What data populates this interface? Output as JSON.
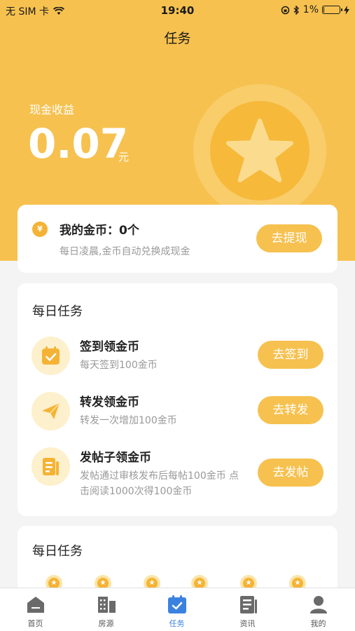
{
  "status_bar": {
    "carrier": "无 SIM 卡",
    "time": "19:40",
    "battery_percent_text": "1%",
    "battery_level": 0.01
  },
  "header": {
    "title": "任务"
  },
  "earnings": {
    "label": "现金收益",
    "value": "0.07",
    "unit": "元"
  },
  "my_coins": {
    "title": "我的金币：0个",
    "subtitle": "每日凌晨,金币自动兑换成现金",
    "button": "去提现"
  },
  "daily_tasks": {
    "title": "每日任务",
    "tasks": [
      {
        "title": "签到领金币",
        "subtitle": "每天签到100金币",
        "button": "去签到",
        "icon": "calendar-check-icon"
      },
      {
        "title": "转发领金币",
        "subtitle": "转发一次增加100金币",
        "button": "去转发",
        "icon": "paper-plane-icon"
      },
      {
        "title": "发帖子领金币",
        "subtitle": "发帖通过审核发布后每帖100金币 点击阅读1000次得100金币",
        "button": "去发帖",
        "icon": "document-icon"
      }
    ]
  },
  "daily_tasks_2": {
    "title": "每日任务"
  },
  "tabs": [
    {
      "label": "首页",
      "icon": "home-icon",
      "active": false
    },
    {
      "label": "房源",
      "icon": "buildings-icon",
      "active": false
    },
    {
      "label": "任务",
      "icon": "calendar-task-icon",
      "active": true
    },
    {
      "label": "资讯",
      "icon": "news-icon",
      "active": false
    },
    {
      "label": "我的",
      "icon": "user-icon",
      "active": false
    }
  ],
  "colors": {
    "accent": "#f6c14f",
    "coin": "#f5b335",
    "tab_active": "#3b82e0",
    "tab_inactive": "#555555"
  }
}
